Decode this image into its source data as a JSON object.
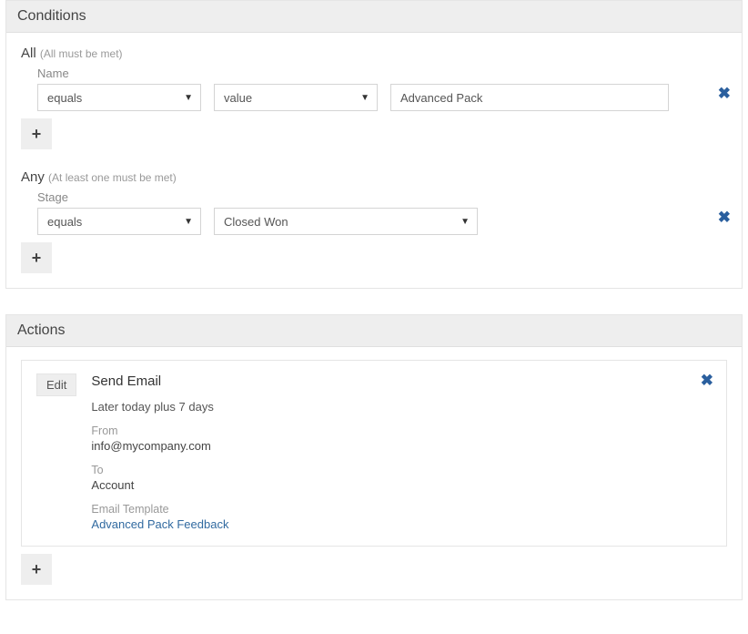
{
  "conditions": {
    "header": "Conditions",
    "all": {
      "title": "All",
      "note": "(All must be met)",
      "row": {
        "field": "Name",
        "operator": "equals",
        "mode": "value",
        "value": "Advanced Pack"
      }
    },
    "any": {
      "title": "Any",
      "note": "(At least one must be met)",
      "row": {
        "field": "Stage",
        "operator": "equals",
        "value": "Closed Won"
      }
    },
    "plus": "+"
  },
  "actions": {
    "header": "Actions",
    "edit": "Edit",
    "item": {
      "title": "Send Email",
      "schedule": "Later today plus 7 days",
      "from_label": "From",
      "from_value": "info@mycompany.com",
      "to_label": "To",
      "to_value": "Account",
      "template_label": "Email Template",
      "template_value": "Advanced Pack Feedback"
    },
    "plus": "+"
  }
}
